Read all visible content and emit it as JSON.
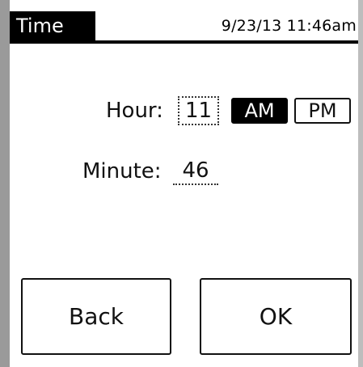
{
  "header": {
    "title": "Time",
    "datetime": "9/23/13  11:46am"
  },
  "form": {
    "hour_label": "Hour:",
    "hour_value": "11",
    "minute_label": "Minute:",
    "minute_value": "46",
    "meridiem": {
      "am_label": "AM",
      "pm_label": "PM",
      "selected": "AM"
    }
  },
  "buttons": {
    "back_label": "Back",
    "ok_label": "OK"
  },
  "colors": {
    "header_bg": "#000000",
    "selected_bg": "#000000",
    "frame": "#9a9a9a"
  }
}
